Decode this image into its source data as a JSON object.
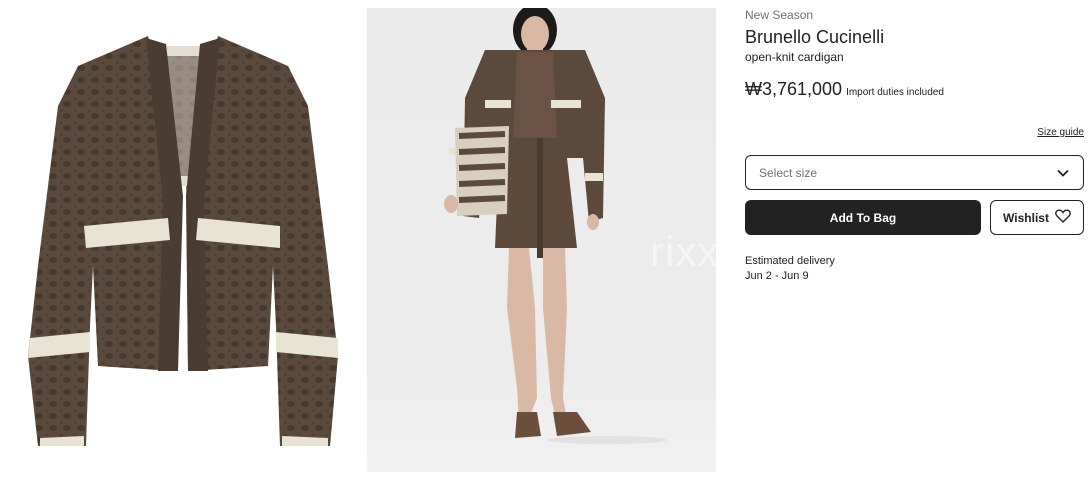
{
  "gallery": {
    "watermark": "rixx",
    "image_1_alt": "open-knit cardigan front view",
    "image_2_alt": "model wearing open-knit cardigan"
  },
  "product": {
    "tag": "New Season",
    "brand": "Brunello Cucinelli",
    "name": "open-knit cardigan",
    "price": "₩3,761,000",
    "duties_note": "Import duties included",
    "size_guide_label": "Size guide",
    "size_placeholder": "Select size",
    "add_to_bag_label": "Add To Bag",
    "wishlist_label": "Wishlist",
    "delivery_label": "Estimated delivery",
    "delivery_dates": "Jun 2 - Jun 9"
  },
  "icons": {
    "select": "chevron-down-icon",
    "wishlist": "heart-icon"
  },
  "colors": {
    "primary": "#222222",
    "muted": "#727272",
    "knit_brown": "#5b4a3c",
    "stripe_cream": "#e9e3d3"
  }
}
